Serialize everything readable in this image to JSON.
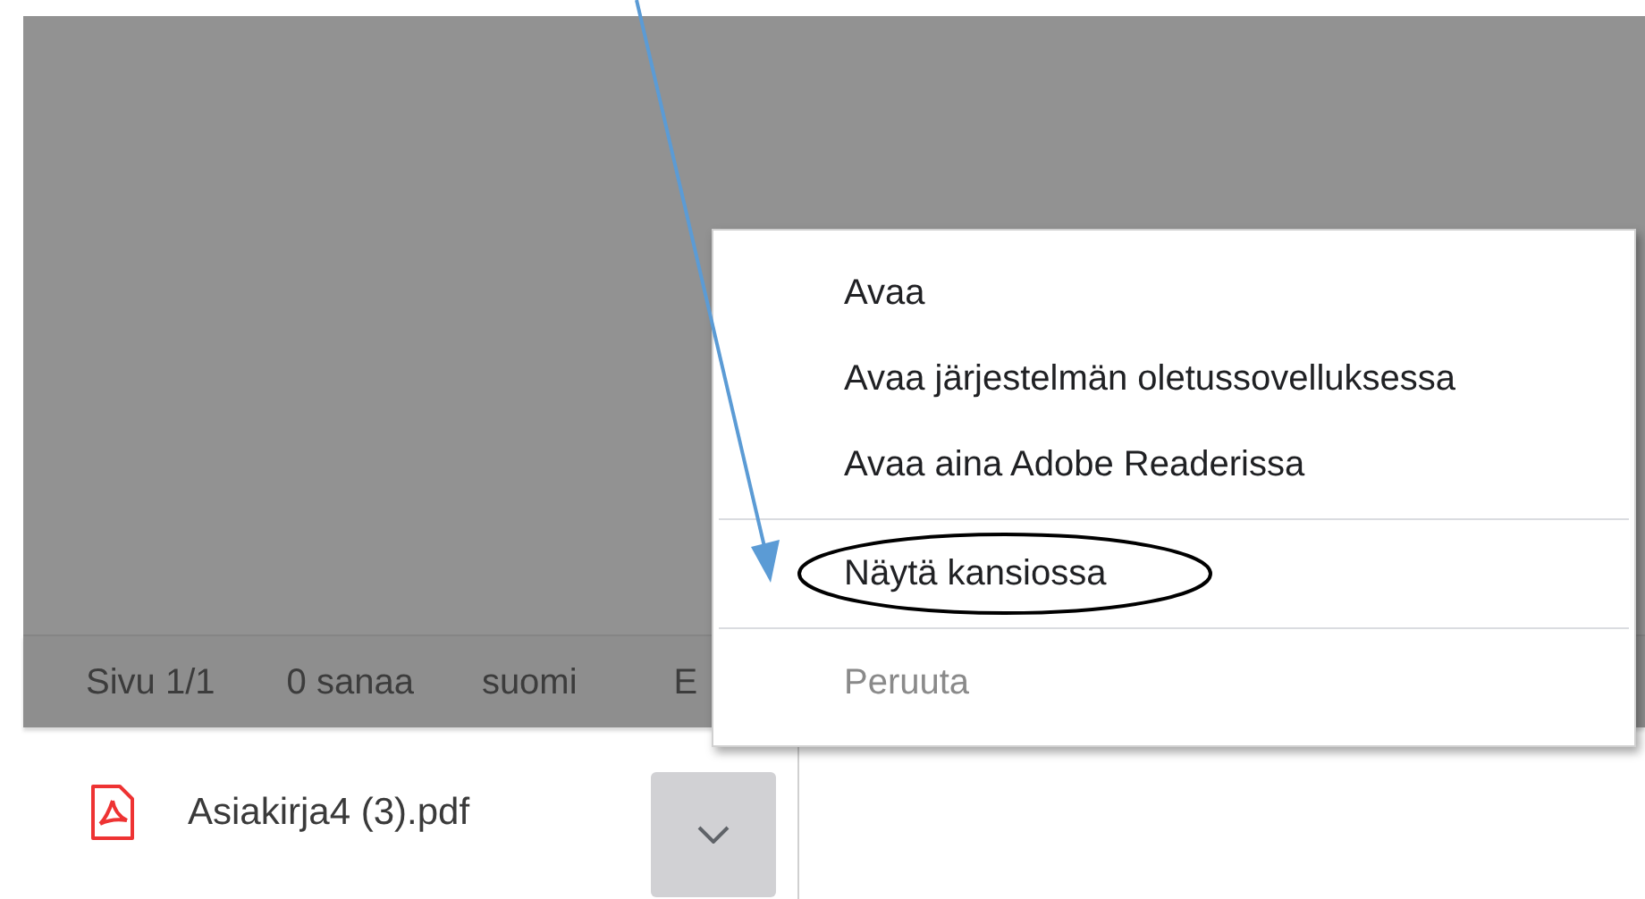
{
  "status_bar": {
    "items": [
      "Sivu 1/1",
      "0 sanaa",
      "suomi",
      "E"
    ]
  },
  "download": {
    "file_name": "Asiakirja4 (3).pdf"
  },
  "context_menu": {
    "items": [
      {
        "kind": "item",
        "label": "Avaa",
        "disabled": false,
        "circled": false
      },
      {
        "kind": "item",
        "label": "Avaa järjestelmän oletussovelluksessa",
        "disabled": false,
        "circled": false
      },
      {
        "kind": "item",
        "label": "Avaa aina Adobe Readerissa",
        "disabled": false,
        "circled": false
      },
      {
        "kind": "separator"
      },
      {
        "kind": "item",
        "label": "Näytä kansiossa",
        "disabled": false,
        "circled": true
      },
      {
        "kind": "separator"
      },
      {
        "kind": "item",
        "label": "Peruuta",
        "disabled": true,
        "circled": false
      }
    ]
  }
}
